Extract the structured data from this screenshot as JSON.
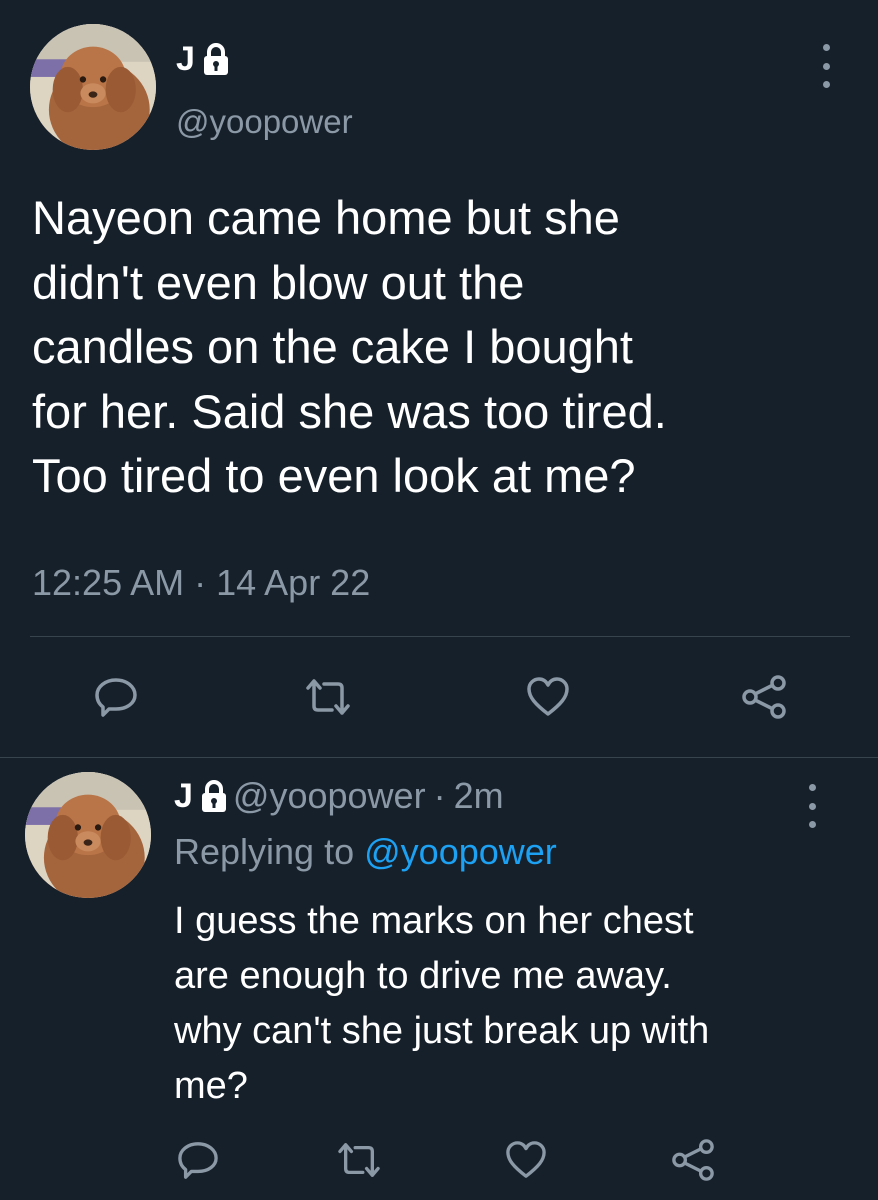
{
  "main_tweet": {
    "display_name": "J",
    "handle": "@yoopower",
    "text": "Nayeon came home but she\ndidn't even blow out the\ncandles on the cake I bought\nfor her. Said she was too tired.\nToo tired to even look at me?",
    "timestamp": "12:25 AM · 14 Apr 22",
    "actions": [
      "reply-icon",
      "retweet-icon",
      "like-icon",
      "share-icon"
    ]
  },
  "reply_tweet": {
    "display_name": "J",
    "handle": "@yoopower",
    "separator": "·",
    "time_ago": "2m",
    "replying_to_label": "Replying to",
    "replying_to_handle": "@yoopower",
    "text": "I guess the marks on her chest\nare enough to drive me away.\nwhy can't she just break up with\nme?",
    "actions": [
      "reply-icon",
      "retweet-icon",
      "like-icon",
      "share-icon"
    ]
  },
  "colors": {
    "background": "#16202b",
    "text": "#ffffff",
    "secondary": "#8b98a5",
    "link": "#1da1f2",
    "divider": "#38444d"
  },
  "icons": {
    "lock": "lock-icon",
    "more": "more-vertical-icon"
  }
}
